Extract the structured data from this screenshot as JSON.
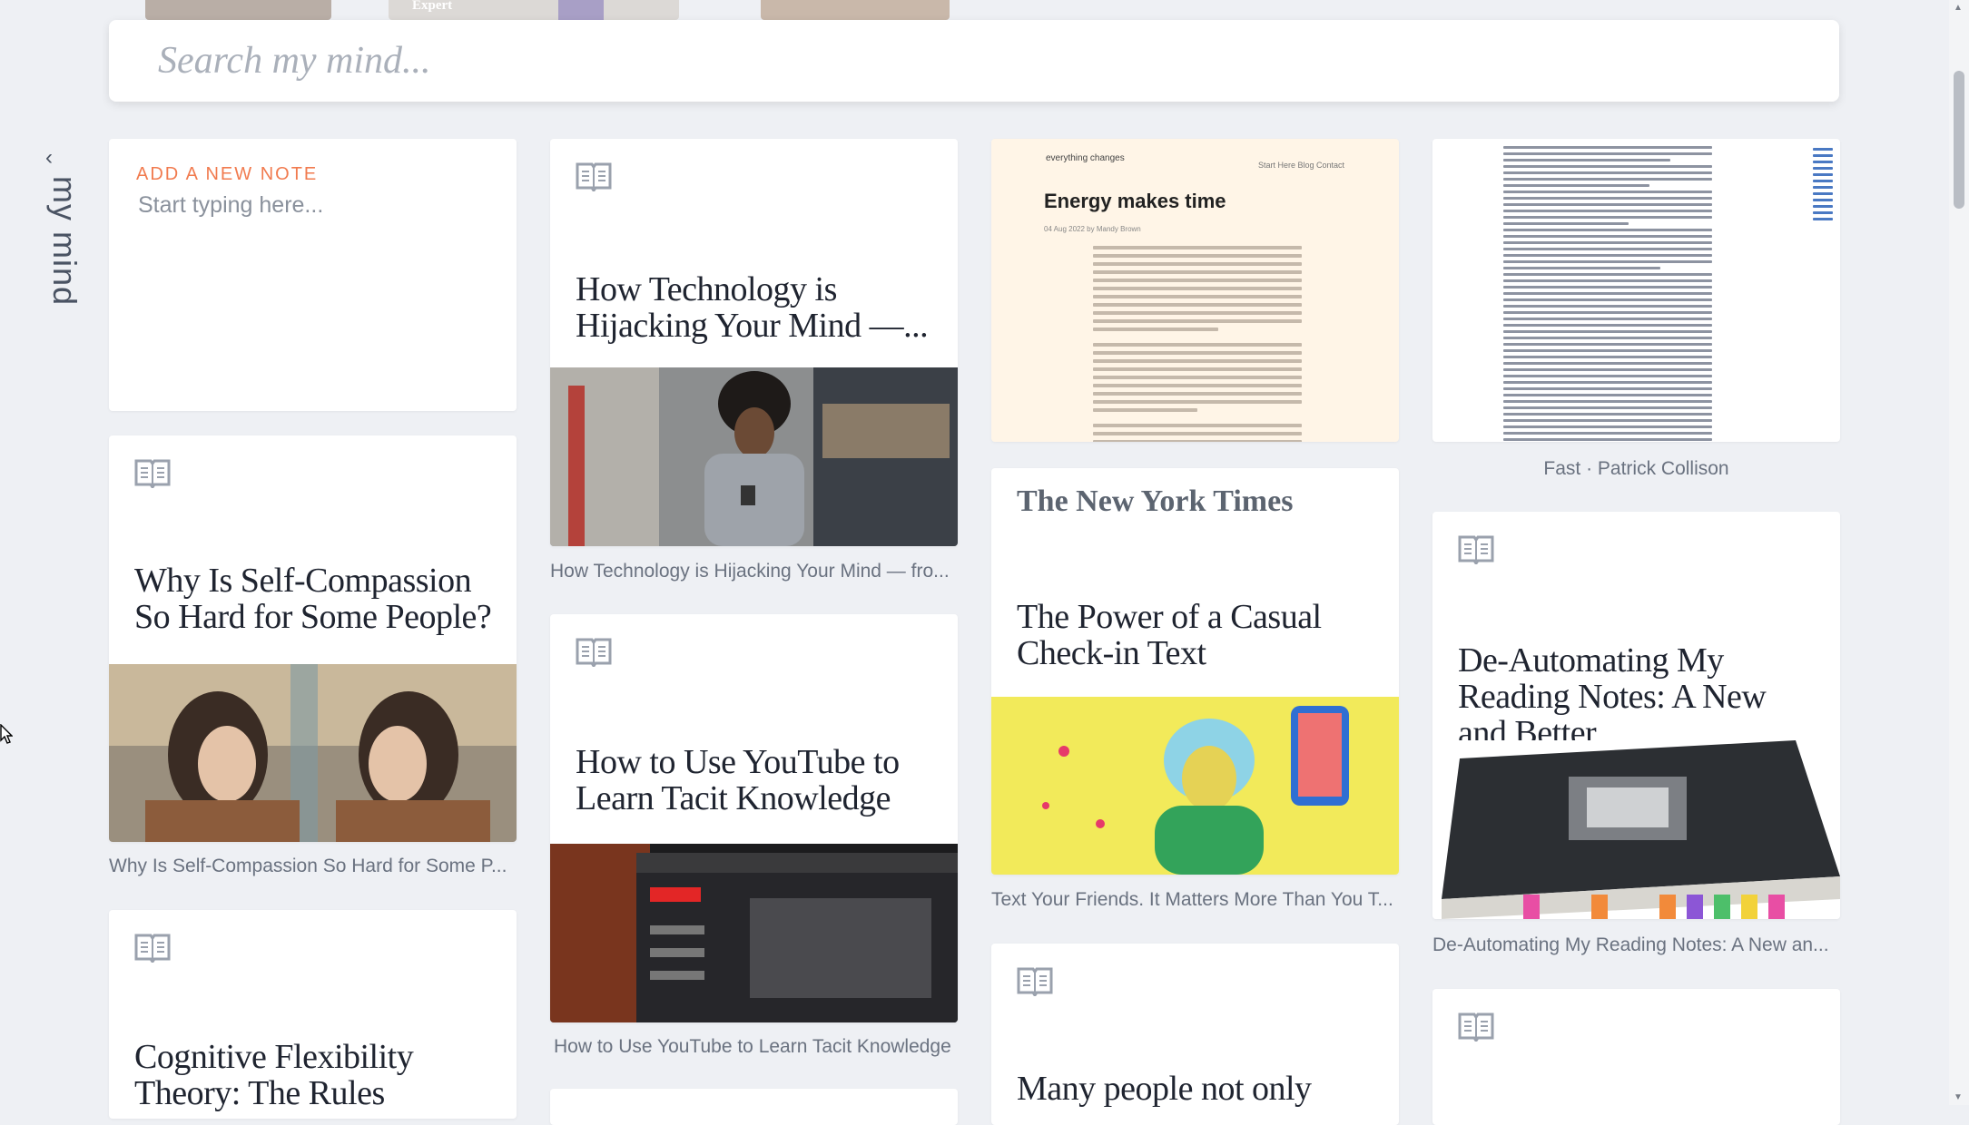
{
  "top_strip": {
    "thumb_text": "Expert"
  },
  "search": {
    "placeholder": "Search my mind..."
  },
  "sidebar": {
    "toggle_label": "my mind",
    "chevron_icon": "chevron-left-icon"
  },
  "new_note": {
    "label": "ADD A NEW NOTE",
    "placeholder": "Start typing here..."
  },
  "cards": {
    "self_compassion": {
      "title": "Why Is Self-Compassion So Hard for Some People?",
      "caption": "Why Is Self-Compassion So Hard for Some P..."
    },
    "cognitive": {
      "title": "Cognitive Flexibility Theory: The Rules"
    },
    "tech_hijack": {
      "title": "How Technology is Hijacking Your Mind —...",
      "caption": "How Technology is Hijacking Your Mind — fro..."
    },
    "youtube": {
      "title": "How to Use YouTube to Learn Tacit Knowledge",
      "caption": "How to Use YouTube to Learn Tacit Knowledge"
    },
    "energy": {
      "brand": "everything changes",
      "nav": "Start Here   Blog   Contact",
      "title": "Energy makes time",
      "meta": "04 Aug 2022       by Mandy Brown"
    },
    "casual_checkin": {
      "publisher": "The New York Times",
      "title": "The Power of a Casual Check-in Text",
      "caption": "Text Your Friends. It Matters More Than You T..."
    },
    "many_people": {
      "title": "Many people not only"
    },
    "fast": {
      "caption": "Fast · Patrick Collison"
    },
    "deautomating": {
      "title": "De-Automating My Reading Notes: A New and Better...",
      "caption": "De-Automating My Reading Notes: A New an..."
    }
  },
  "colors": {
    "accent": "#f17b4f",
    "background": "#eef0f4"
  }
}
